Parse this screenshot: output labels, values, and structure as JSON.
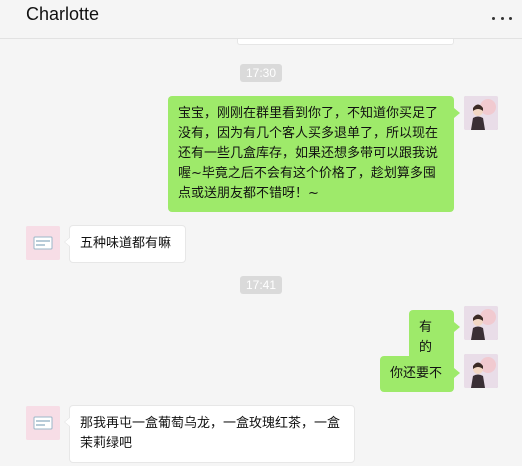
{
  "header": {
    "title": "Charlotte",
    "more_icon": "more-horizontal-icon"
  },
  "colors": {
    "self_bubble": "#9eea6a",
    "other_bubble": "#ffffff",
    "timestamp_bg": "#dadada",
    "background": "#f5f5f5"
  },
  "messages": {
    "time_1": "17:30",
    "msg_1": "宝宝，刚刚在群里看到你了，不知道你买足了没有，因为有几个客人买多退单了，所以现在还有一些几盒库存，如果还想多带可以跟我说喔~毕竟之后不会有这个价格了，趁划算多囤点或送朋友都不错呀！~",
    "msg_2": "五种味道都有嘛",
    "time_2": "17:41",
    "msg_3": "有的",
    "msg_4": "你还要不",
    "msg_5": "那我再屯一盒葡萄乌龙，一盒玫瑰红茶，一盒茉莉绿吧"
  }
}
